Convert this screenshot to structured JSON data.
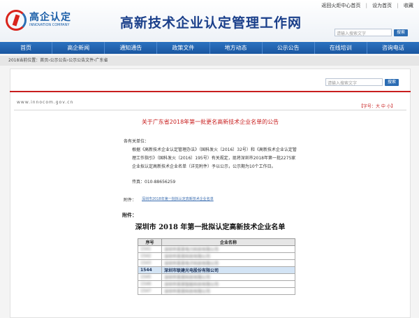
{
  "header": {
    "logo_cn": "高企认定",
    "logo_en": "INNOVATION COMPANY",
    "site_title": "高新技术企业认定管理工作网",
    "top_links": [
      "返回火炬中心首页",
      "设为首页",
      "收藏"
    ],
    "search_placeholder": "请输入搜索文字",
    "search_button": "搜索"
  },
  "nav": {
    "items": [
      "首页",
      "高企新闻",
      "通知通告",
      "政策文件",
      "地方动态",
      "公示公告",
      "在线培训",
      "咨询电话"
    ]
  },
  "breadcrumb": "2018当前位置：首页›公示公告›公示公告文件›广东省",
  "content": {
    "search_placeholder": "请输入搜索文字",
    "search_button": "搜索",
    "domain": "www.innocom.gov.cn",
    "font_size_control": "【字号：大 中 小】",
    "notice_title": "关于广东省2018年第一批更名高新技术企业名单的公告",
    "salutation": "各有关单位：",
    "paragraph": "根据《高新技术企业认定管理办法》（国科发火〔2016〕32号）和《高新技术企业认定管理工作指引》（国科发火〔2016〕195号）有关规定，现将深圳市2018年第一批2275家企业拟认定高新技术企业名单（详见附件）予以公示，公示期为10个工作日。",
    "contact": "传真：010-88656259",
    "attachment_label": "附件：",
    "attachment_link": "深圳市2018年第一批拟认定高新技术企业名单",
    "attachment_heading": "附件：",
    "list_title": "深圳市 2018 年第一批拟认定高新技术企业名单",
    "table": {
      "headers": [
        "序号",
        "企业名称"
      ],
      "rows": [
        {
          "num": "1541",
          "name": "深圳市某某电力科技有限公司",
          "highlight": false
        },
        {
          "num": "1542",
          "name": "深圳市某某科技有限公司",
          "highlight": false
        },
        {
          "num": "1543",
          "name": "深圳市某某电子科技有限公司",
          "highlight": false
        },
        {
          "num": "1544",
          "name": "深圳市联建光电股份有限公司",
          "highlight": true
        },
        {
          "num": "1545",
          "name": "深圳市某某科技有限公司",
          "highlight": false
        },
        {
          "num": "1546",
          "name": "深圳市某某智能科技有限公司",
          "highlight": false
        },
        {
          "num": "1547",
          "name": "深圳市某某科技有限公司",
          "highlight": false
        }
      ]
    }
  }
}
